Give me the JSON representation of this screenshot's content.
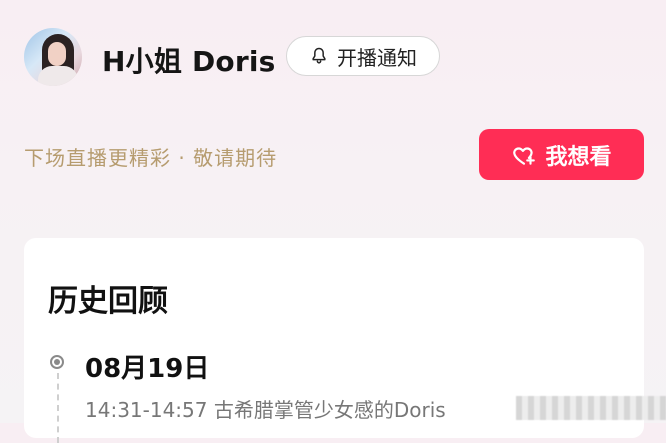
{
  "header": {
    "host_name": "H小姐 Doris",
    "avatar_icon": "profile-photo",
    "notify_label": "开播通知",
    "notify_icon": "bell-icon"
  },
  "schedule": {
    "text": "下场直播更精彩 · 敬请期待"
  },
  "want_button": {
    "label": "我想看",
    "icon": "heart-plus-icon"
  },
  "history": {
    "title": "历史回顾",
    "items": [
      {
        "date": "08月19日",
        "detail": "14:31-14:57 古希腊掌管少女感的Doris"
      }
    ]
  },
  "colors": {
    "accent": "#ff2d55",
    "schedule_text": "#b69c6f"
  }
}
